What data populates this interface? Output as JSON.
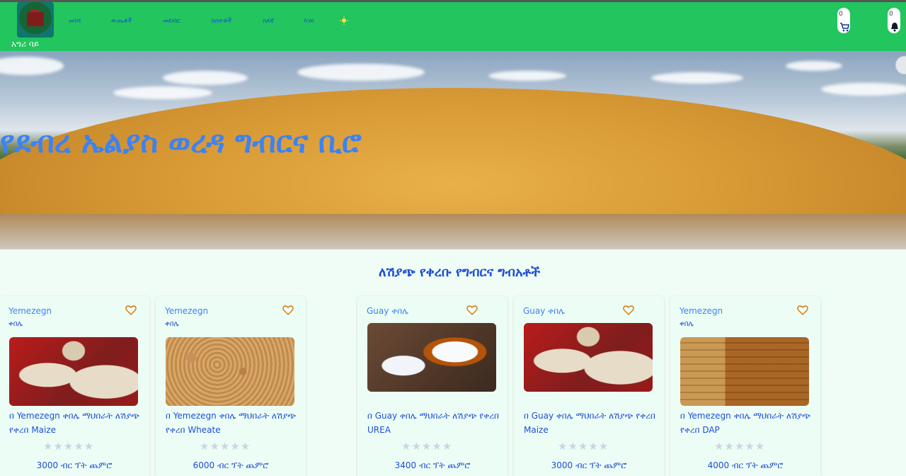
{
  "navbar": {
    "brand": "አግሪ ባይ",
    "items": [
      "መነሻ",
      "ውጤቶች",
      "መደብር",
      "ክስተቶች",
      "ስለኛ",
      "እገዛ"
    ],
    "theme_icon": "sun-icon",
    "cart": {
      "count": "0",
      "icon": "cart-icon"
    },
    "notifications": {
      "count": "0",
      "icon": "bell-icon"
    },
    "accent": "#22c55e"
  },
  "hero": {
    "title": "የደብረ ኤልያስ ወረዳ ግብርና ቢሮ"
  },
  "section": {
    "title": "ለሽያጭ የቀረቡ የግብርና ግብአቶች"
  },
  "products": [
    {
      "seller": "Yemezegn",
      "union": "ቀበሌ",
      "desc": "በ Yemezegn ቀበሌ ማህበራት ለሽያጭ የቀረበ Maize",
      "price": "3000 ብር ፕት ጨምሮ",
      "image": "sacks",
      "rating": 0
    },
    {
      "seller": "Yemezegn",
      "union": "ቀበሌ",
      "desc": "በ Yemezegn ቀበሌ ማህበራት ለሽያጭ የቀረበ Wheate",
      "price": "6000 ብር ፕት ጨምሮ",
      "image": "wheat",
      "rating": 0
    },
    {
      "seller": "Guay ቀበሌ",
      "union": "",
      "desc": "በ Guay ቀበሌ ማህበራት ለሽያጭ የቀረበ UREA",
      "price": "3400 ብር ፕት ጨምሮ",
      "image": "salt",
      "rating": 0
    },
    {
      "seller": "Guay ቀበሌ",
      "union": "",
      "desc": "በ Guay ቀበሌ ማህበራት ለሽያጭ የቀረበ Maize",
      "price": "3000 ብር ፕት ጨምሮ",
      "image": "sacks",
      "rating": 0
    },
    {
      "seller": "Yemezegn",
      "union": "ቀበሌ",
      "desc": "በ Yemezegn ቀበሌ ማህበራት ለሽያጭ የቀረበ DAP",
      "price": "4000 ብር ፕት ጨምሮ",
      "image": "warehouse",
      "rating": 0
    }
  ],
  "stars": "★★★★★"
}
